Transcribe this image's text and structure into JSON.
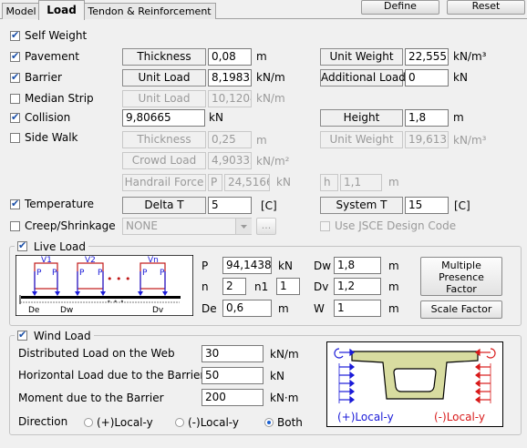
{
  "tabs": [
    "Model",
    "Load",
    "Tendon & Reinforcement"
  ],
  "top_buttons": {
    "define": "Define",
    "reset": "Reset"
  },
  "loads": {
    "self_weight": "Self Weight",
    "pavement": {
      "label": "Pavement",
      "thickness_label": "Thickness",
      "thickness": "0,08",
      "thickness_unit": "m",
      "unit_weight_label": "Unit Weight",
      "unit_weight": "22,5552",
      "unit_weight_unit": "kN/m³"
    },
    "barrier": {
      "label": "Barrier",
      "unit_load_label": "Unit Load",
      "unit_load": "8,19835",
      "unit_load_unit": "kN/m",
      "additional_label": "Additional Load",
      "additional": "0",
      "additional_unit": "kN"
    },
    "median": {
      "label": "Median Strip",
      "unit_load_label": "Unit Load",
      "unit_load": "10,1204",
      "unit_load_unit": "kN/m"
    },
    "collision": {
      "label": "Collision",
      "value": "9,80665",
      "unit": "kN",
      "height_label": "Height",
      "height": "1,8",
      "height_unit": "m"
    },
    "sidewalk": {
      "label": "Side Walk",
      "thickness_label": "Thickness",
      "thickness": "0,25",
      "thickness_unit": "m",
      "unit_weight_label": "Unit Weight",
      "unit_weight": "19,6133",
      "unit_weight_unit": "kN/m³",
      "crowd_label": "Crowd Load",
      "crowd": "4,90332",
      "crowd_unit": "kN/m²",
      "handrail_label": "Handrail Force",
      "handrail_p": "P",
      "handrail": "24,5166",
      "handrail_unit": "kN",
      "h_label": "h",
      "h": "1,1",
      "h_unit": "m"
    },
    "temperature": {
      "label": "Temperature",
      "delta_label": "Delta T",
      "delta": "5",
      "delta_unit": "[C]",
      "system_label": "System T",
      "system": "15",
      "system_unit": "[C]"
    },
    "creep": {
      "label": "Creep/Shrinkage",
      "select": "NONE",
      "more": "...",
      "jsce": "Use JSCE Design Code"
    }
  },
  "live_load": {
    "title": "Live Load",
    "diagram": {
      "v1": "V1",
      "v2": "V2",
      "vn": "Vn",
      "p": "P",
      "de": "De",
      "dw": "Dw",
      "dv": "Dv",
      "dots": "• • •"
    },
    "p_label": "P",
    "p": "94,14384",
    "p_unit": "kN",
    "n_label": "n",
    "n": "2",
    "n1_label": "n1",
    "n1": "1",
    "de_label": "De",
    "de": "0,6",
    "de_unit": "m",
    "dw_label": "Dw",
    "dw": "1,8",
    "dw_unit": "m",
    "dv_label": "Dv",
    "dv": "1,2",
    "dv_unit": "m",
    "w_label": "W",
    "w": "1",
    "w_unit": "m",
    "mpf_button": [
      "Multiple",
      "Presence",
      "Factor"
    ],
    "scale_button": "Scale Factor"
  },
  "wind_load": {
    "title": "Wind Load",
    "distributed_label": "Distributed Load on the Web",
    "distributed": "30",
    "distributed_unit": "kN/m",
    "horizontal_label": "Horizontal Load due to the Barrier",
    "horizontal": "50",
    "horizontal_unit": "kN",
    "moment_label": "Moment due to the Barrier",
    "moment": "200",
    "moment_unit": "kN·m",
    "direction_label": "Direction",
    "options": [
      "(+)Local-y",
      "(-)Local-y",
      "Both"
    ],
    "selected": "Both",
    "diagram": {
      "pos": "(+)Local-y",
      "neg": "(-)Local-y"
    }
  },
  "colors": {
    "positive": "#1a1ad8",
    "negative": "#d81a1a",
    "section_fill": "#d8dca0",
    "checkmark": "#1a4fa8"
  }
}
